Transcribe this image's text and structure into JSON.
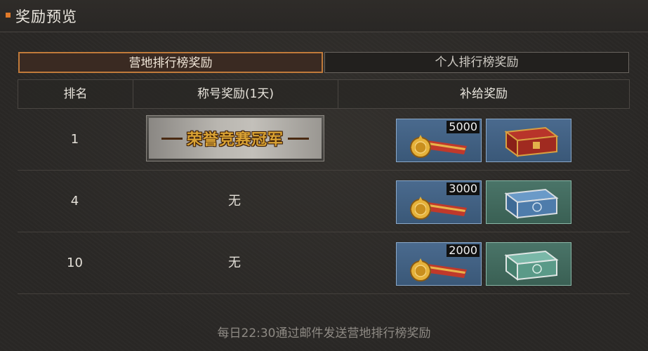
{
  "header": {
    "title": "奖励预览"
  },
  "tabs": [
    {
      "label": "营地排行榜奖励",
      "active": true
    },
    {
      "label": "个人排行榜奖励",
      "active": false
    }
  ],
  "table": {
    "columns": [
      "排名",
      "称号奖励(1天)",
      "补给奖励"
    ],
    "rows": [
      {
        "rank": "1",
        "title": "荣誉竞赛冠军",
        "medal_count": "5000",
        "chest": "red-chest-icon"
      },
      {
        "rank": "4",
        "title": "无",
        "medal_count": "3000",
        "chest": "blue-chest-icon"
      },
      {
        "rank": "10",
        "title": "无",
        "medal_count": "2000",
        "chest": "teal-chest-icon"
      }
    ]
  },
  "footer": {
    "note": "每日22:30通过邮件发送营地排行榜奖励"
  },
  "colors": {
    "accent": "#e07a2a",
    "active_tab_border": "#c07a3a",
    "badge_text": "#d9a234"
  }
}
